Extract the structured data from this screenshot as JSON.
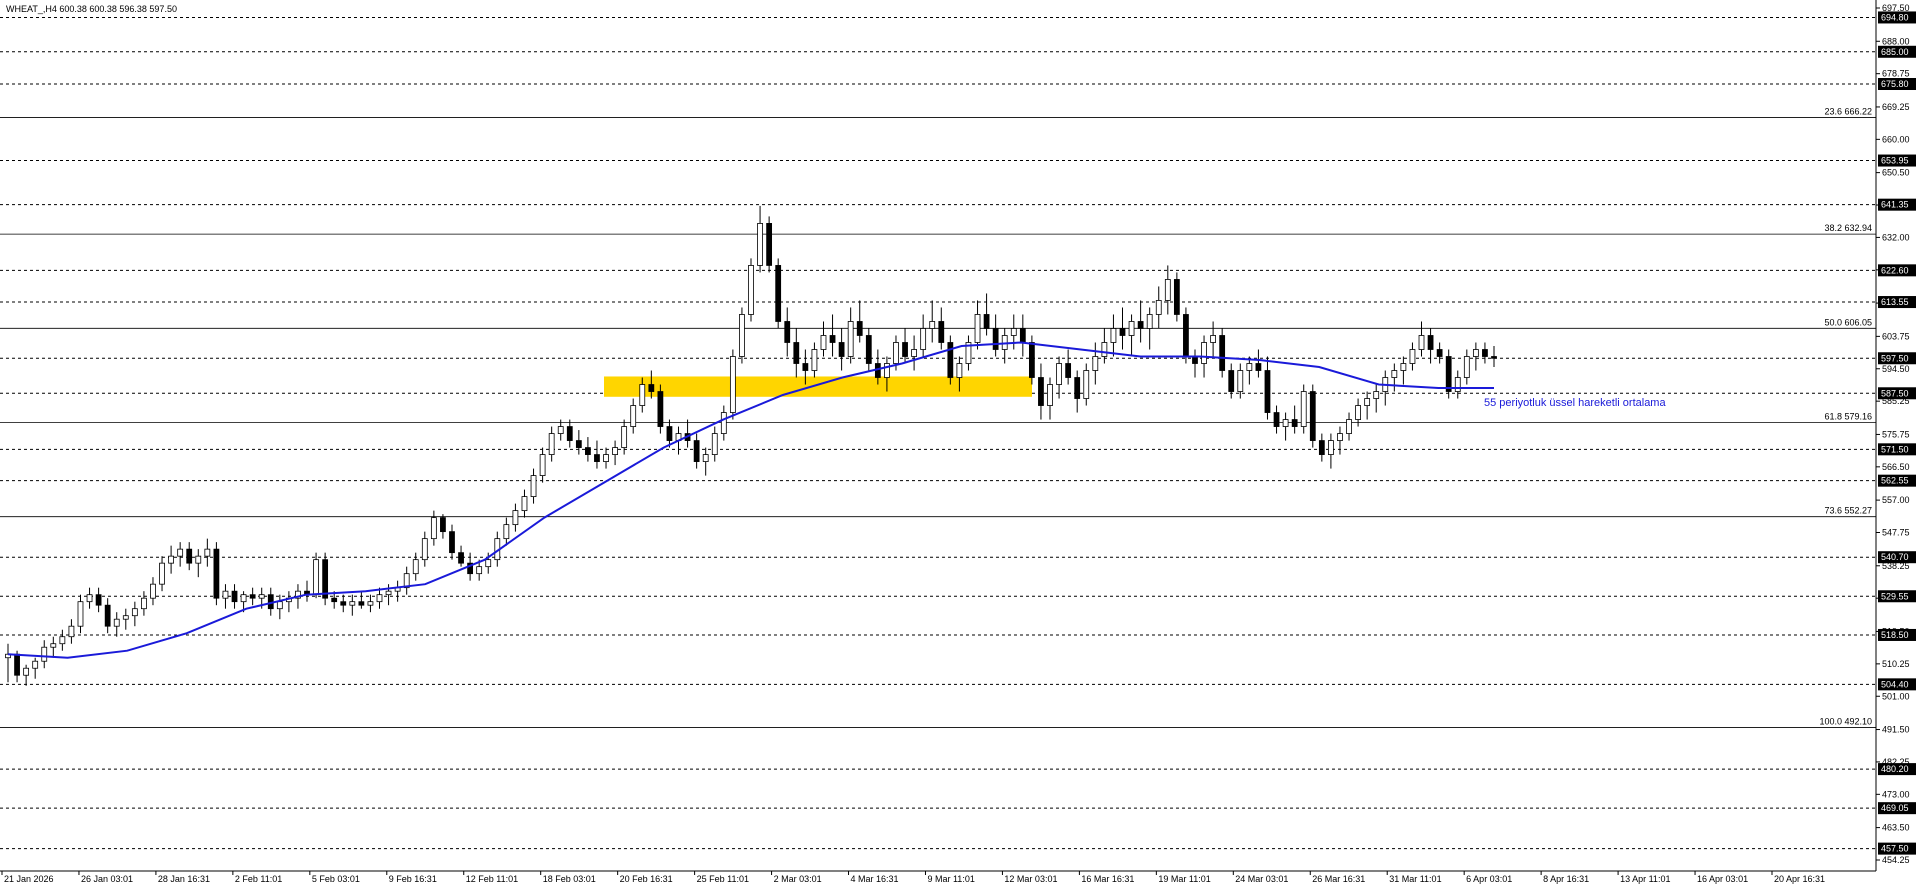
{
  "chart_data": {
    "type": "candlestick",
    "title": "WHEAT_,H4  600.38 600.38 596.38 597.50",
    "symbol": "WHEAT_",
    "timeframe": "H4",
    "ohlc_header": [
      "600.38",
      "600.38",
      "596.38",
      "597.50"
    ],
    "ylim": [
      454.25,
      697.5
    ],
    "x_tick_labels": [
      "21 Jan 2026",
      "26 Jan 03:01",
      "28 Jan 16:31",
      "2 Feb 11:01",
      "5 Feb 03:01",
      "9 Feb 16:31",
      "12 Feb 11:01",
      "18 Feb 03:01",
      "20 Feb 16:31",
      "25 Feb 11:01",
      "2 Mar 03:01",
      "4 Mar 16:31",
      "9 Mar 11:01",
      "12 Mar 03:01",
      "16 Mar 16:31",
      "19 Mar 11:01",
      "24 Mar 03:01",
      "26 Mar 16:31",
      "31 Mar 11:01",
      "6 Apr 03:01",
      "8 Apr 16:31",
      "13 Apr 11:01",
      "16 Apr 03:01",
      "20 Apr 16:31"
    ],
    "y_tick_labels": [
      697.5,
      688.0,
      678.75,
      669.25,
      660.0,
      650.5,
      641.25,
      632.0,
      622.75,
      613.25,
      603.75,
      594.5,
      585.25,
      575.75,
      566.5,
      557.0,
      547.75,
      538.25,
      529.0,
      519.5,
      510.25,
      501.0,
      491.5,
      482.25,
      473.0,
      463.5,
      454.25
    ],
    "horizontal_levels": [
      "694.80",
      "685.00",
      "675.80",
      "653.95",
      "641.35",
      "622.60",
      "613.55",
      "597.50",
      "587.50",
      "571.50",
      "562.55",
      "540.70",
      "529.55",
      "518.50",
      "504.40",
      "480.20",
      "469.05",
      "457.50"
    ],
    "current_price": "597.50",
    "fibonacci_levels": [
      {
        "label": "23.6 666.22",
        "price": 666.22
      },
      {
        "label": "38.2 632.94",
        "price": 632.94
      },
      {
        "label": "50.0 606.05",
        "price": 606.05
      },
      {
        "label": "61.8 579.16",
        "price": 579.16
      },
      {
        "label": "73.6 552.27",
        "price": 552.27
      },
      {
        "label": "100.0 492.10",
        "price": 492.1
      }
    ],
    "support_zone": {
      "low": 586.5,
      "high": 592.3,
      "color": "#ffd500"
    },
    "annotation": "55 periyotluk üssel hareketli ortalama",
    "ema_color": "#1a1ad9",
    "candles": [
      [
        512,
        516,
        505,
        513
      ],
      [
        513,
        514,
        505,
        507
      ],
      [
        507,
        510,
        504,
        509
      ],
      [
        509,
        512,
        506,
        511
      ],
      [
        511,
        517,
        509,
        515
      ],
      [
        515,
        518,
        512,
        516
      ],
      [
        516,
        520,
        514,
        518
      ],
      [
        518,
        523,
        516,
        521
      ],
      [
        521,
        530,
        519,
        528
      ],
      [
        528,
        532,
        526,
        530
      ],
      [
        530,
        532,
        525,
        527
      ],
      [
        527,
        529,
        519,
        521
      ],
      [
        521,
        525,
        518,
        523
      ],
      [
        523,
        526,
        520,
        524
      ],
      [
        524,
        528,
        521,
        526
      ],
      [
        526,
        531,
        524,
        529
      ],
      [
        529,
        535,
        527,
        533
      ],
      [
        533,
        541,
        531,
        539
      ],
      [
        539,
        544,
        536,
        541
      ],
      [
        541,
        545,
        538,
        543
      ],
      [
        543,
        545,
        537,
        539
      ],
      [
        539,
        543,
        535,
        541
      ],
      [
        541,
        546,
        538,
        543
      ],
      [
        543,
        545,
        527,
        529
      ],
      [
        529,
        533,
        526,
        531
      ],
      [
        531,
        533,
        526,
        528
      ],
      [
        528,
        531,
        525,
        530
      ],
      [
        530,
        532,
        527,
        529
      ],
      [
        529,
        532,
        526,
        530
      ],
      [
        530,
        532,
        524,
        526
      ],
      [
        526,
        530,
        523,
        528
      ],
      [
        528,
        531,
        525,
        529
      ],
      [
        529,
        533,
        526,
        531
      ],
      [
        531,
        534,
        528,
        530
      ],
      [
        530,
        542,
        529,
        540
      ],
      [
        540,
        542,
        527,
        529
      ],
      [
        529,
        531,
        526,
        528
      ],
      [
        528,
        530,
        525,
        527
      ],
      [
        527,
        530,
        524,
        528
      ],
      [
        528,
        531,
        526,
        527
      ],
      [
        527,
        530,
        525,
        528
      ],
      [
        528,
        532,
        526,
        530
      ],
      [
        530,
        533,
        527,
        531
      ],
      [
        531,
        534,
        528,
        532
      ],
      [
        532,
        538,
        530,
        536
      ],
      [
        536,
        542,
        534,
        540
      ],
      [
        540,
        548,
        538,
        546
      ],
      [
        546,
        554,
        544,
        552
      ],
      [
        552,
        553,
        546,
        548
      ],
      [
        548,
        550,
        540,
        542
      ],
      [
        542,
        544,
        538,
        539
      ],
      [
        539,
        542,
        534,
        536
      ],
      [
        536,
        540,
        534,
        538
      ],
      [
        538,
        542,
        536,
        540
      ],
      [
        540,
        548,
        538,
        546
      ],
      [
        546,
        552,
        544,
        550
      ],
      [
        550,
        556,
        548,
        554
      ],
      [
        554,
        560,
        552,
        558
      ],
      [
        558,
        566,
        556,
        564
      ],
      [
        564,
        572,
        562,
        570
      ],
      [
        570,
        578,
        568,
        576
      ],
      [
        576,
        580,
        574,
        578
      ],
      [
        578,
        580,
        572,
        574
      ],
      [
        574,
        577,
        570,
        572
      ],
      [
        572,
        575,
        568,
        570
      ],
      [
        570,
        574,
        566,
        568
      ],
      [
        568,
        572,
        566,
        570
      ],
      [
        570,
        574,
        567,
        572
      ],
      [
        572,
        580,
        570,
        578
      ],
      [
        578,
        586,
        576,
        584
      ],
      [
        584,
        592,
        582,
        590
      ],
      [
        590,
        594,
        586,
        588
      ],
      [
        588,
        590,
        576,
        578
      ],
      [
        578,
        580,
        572,
        574
      ],
      [
        574,
        578,
        570,
        576
      ],
      [
        576,
        580,
        572,
        574
      ],
      [
        574,
        576,
        566,
        568
      ],
      [
        568,
        572,
        564,
        570
      ],
      [
        570,
        578,
        568,
        576
      ],
      [
        576,
        584,
        574,
        582
      ],
      [
        582,
        600,
        580,
        598
      ],
      [
        598,
        612,
        596,
        610
      ],
      [
        610,
        626,
        608,
        624
      ],
      [
        624,
        641,
        622,
        636
      ],
      [
        636,
        638,
        622,
        624
      ],
      [
        624,
        626,
        606,
        608
      ],
      [
        608,
        612,
        598,
        602
      ],
      [
        602,
        606,
        592,
        596
      ],
      [
        596,
        600,
        590,
        594
      ],
      [
        594,
        602,
        592,
        600
      ],
      [
        600,
        608,
        598,
        604
      ],
      [
        604,
        610,
        598,
        602
      ],
      [
        602,
        606,
        594,
        598
      ],
      [
        598,
        612,
        596,
        608
      ],
      [
        608,
        614,
        602,
        604
      ],
      [
        604,
        606,
        594,
        596
      ],
      [
        596,
        600,
        590,
        592
      ],
      [
        592,
        598,
        588,
        596
      ],
      [
        596,
        604,
        594,
        602
      ],
      [
        602,
        606,
        596,
        598
      ],
      [
        598,
        604,
        594,
        600
      ],
      [
        600,
        610,
        598,
        606
      ],
      [
        606,
        614,
        602,
        608
      ],
      [
        608,
        612,
        600,
        602
      ],
      [
        602,
        604,
        590,
        592
      ],
      [
        592,
        598,
        588,
        596
      ],
      [
        596,
        604,
        594,
        602
      ],
      [
        602,
        614,
        600,
        610
      ],
      [
        610,
        616,
        604,
        606
      ],
      [
        606,
        610,
        598,
        600
      ],
      [
        600,
        606,
        596,
        604
      ],
      [
        604,
        610,
        600,
        606
      ],
      [
        606,
        610,
        598,
        602
      ],
      [
        602,
        604,
        590,
        592
      ],
      [
        592,
        596,
        580,
        584
      ],
      [
        584,
        592,
        580,
        590
      ],
      [
        590,
        598,
        586,
        596
      ],
      [
        596,
        600,
        590,
        592
      ],
      [
        592,
        594,
        582,
        586
      ],
      [
        586,
        596,
        584,
        594
      ],
      [
        594,
        602,
        590,
        598
      ],
      [
        598,
        606,
        596,
        602
      ],
      [
        602,
        610,
        598,
        606
      ],
      [
        606,
        612,
        600,
        604
      ],
      [
        604,
        610,
        598,
        608
      ],
      [
        608,
        614,
        602,
        606
      ],
      [
        606,
        612,
        600,
        610
      ],
      [
        610,
        618,
        606,
        614
      ],
      [
        614,
        624,
        610,
        620
      ],
      [
        620,
        622,
        608,
        610
      ],
      [
        610,
        612,
        596,
        598
      ],
      [
        598,
        600,
        592,
        596
      ],
      [
        596,
        604,
        592,
        602
      ],
      [
        602,
        608,
        598,
        604
      ],
      [
        604,
        606,
        592,
        594
      ],
      [
        594,
        596,
        586,
        588
      ],
      [
        588,
        596,
        586,
        594
      ],
      [
        594,
        598,
        590,
        596
      ],
      [
        596,
        600,
        592,
        594
      ],
      [
        594,
        598,
        580,
        582
      ],
      [
        582,
        584,
        576,
        578
      ],
      [
        578,
        582,
        574,
        580
      ],
      [
        580,
        584,
        576,
        578
      ],
      [
        578,
        590,
        576,
        588
      ],
      [
        588,
        590,
        572,
        574
      ],
      [
        574,
        576,
        568,
        570
      ],
      [
        570,
        576,
        566,
        574
      ],
      [
        574,
        578,
        570,
        576
      ],
      [
        576,
        582,
        574,
        580
      ],
      [
        580,
        586,
        578,
        584
      ],
      [
        584,
        588,
        580,
        586
      ],
      [
        586,
        590,
        582,
        588
      ],
      [
        588,
        594,
        584,
        592
      ],
      [
        592,
        596,
        588,
        594
      ],
      [
        594,
        598,
        590,
        596
      ],
      [
        596,
        602,
        594,
        600
      ],
      [
        600,
        608,
        598,
        604
      ],
      [
        604,
        606,
        596,
        600
      ],
      [
        600,
        602,
        596,
        598
      ],
      [
        598,
        600,
        586,
        588
      ],
      [
        588,
        594,
        586,
        592
      ],
      [
        592,
        600,
        590,
        598
      ],
      [
        598,
        602,
        594,
        600
      ],
      [
        600,
        602,
        596,
        598
      ],
      [
        598,
        601,
        595,
        597.5
      ]
    ],
    "ema55": [
      [
        0,
        513
      ],
      [
        15,
        512
      ],
      [
        30,
        514
      ],
      [
        45,
        519
      ],
      [
        60,
        526
      ],
      [
        75,
        530
      ],
      [
        90,
        531
      ],
      [
        105,
        533
      ],
      [
        120,
        540
      ],
      [
        135,
        552
      ],
      [
        150,
        562
      ],
      [
        165,
        572
      ],
      [
        180,
        580
      ],
      [
        195,
        587
      ],
      [
        210,
        592
      ],
      [
        225,
        596
      ],
      [
        240,
        601
      ],
      [
        255,
        602
      ],
      [
        270,
        600
      ],
      [
        285,
        598
      ],
      [
        300,
        598
      ],
      [
        315,
        597
      ],
      [
        330,
        595
      ],
      [
        345,
        590
      ],
      [
        360,
        589
      ],
      [
        374,
        589
      ]
    ],
    "xlabel": "",
    "ylabel": ""
  }
}
